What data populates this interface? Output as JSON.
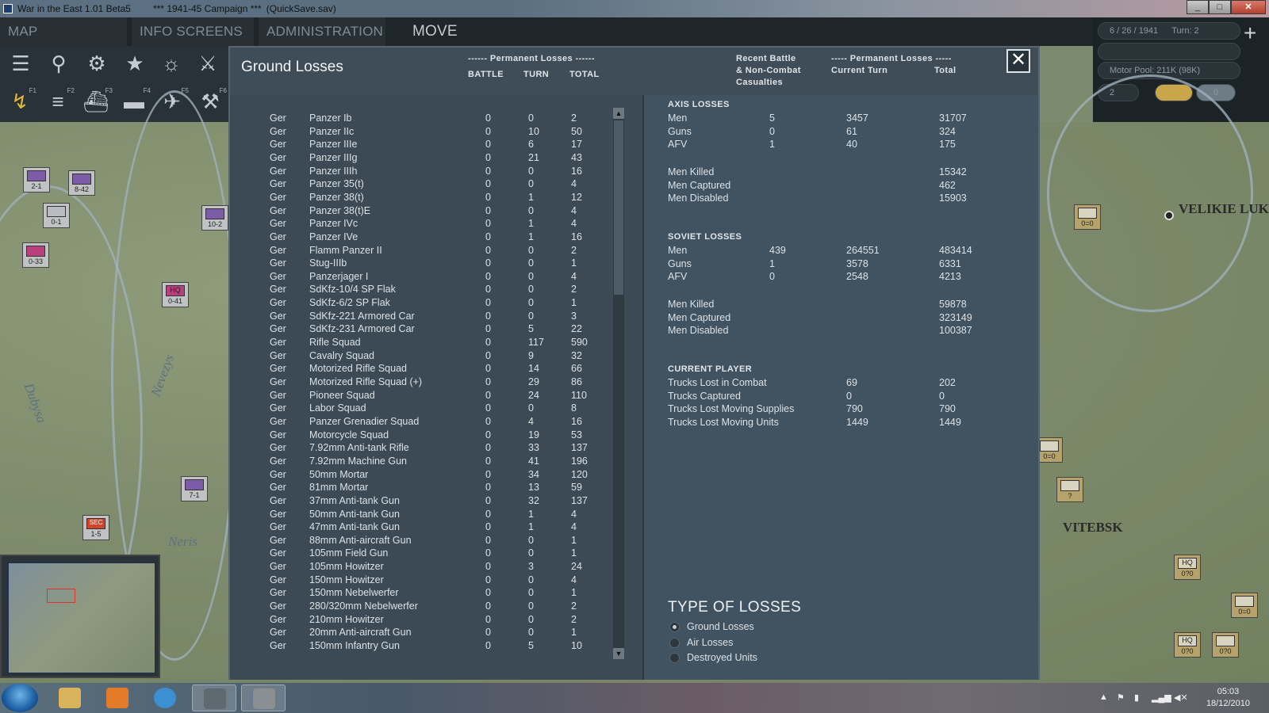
{
  "window": {
    "title": "War in the East 1.01 Beta5",
    "campaign": "***   1941-45 Campaign   ***",
    "save": "(QuickSave.sav)"
  },
  "menu": {
    "tabs": [
      "MAP INFORMATION",
      "INFO SCREENS",
      "ADMINISTRATION"
    ],
    "mode": "MOVE"
  },
  "toolbar": {
    "fkeys": [
      "F1",
      "F2",
      "F3",
      "F4",
      "F5",
      "F6"
    ]
  },
  "status": {
    "date": "6 / 26 / 1941",
    "turn": "Turn: 2",
    "motor_pool": "Motor Pool: 211K (98K)",
    "field": "2",
    "counter": "0"
  },
  "map": {
    "labels": [
      "VELIKIE LUK",
      "VITEBSK"
    ],
    "rivers": [
      "Dubysa",
      "Nevezys",
      "Neris"
    ],
    "units": [
      {
        "id": "2-1",
        "top": "III"
      },
      {
        "id": "8-42",
        "top": "XX"
      },
      {
        "id": "0-1",
        "top": "XXX"
      },
      {
        "id": "0-33",
        "top": "XX"
      },
      {
        "id": "10-2",
        "top": "XX"
      },
      {
        "id": "0-41",
        "top": "XXXX"
      },
      {
        "id": "7-1",
        "top": "XX"
      },
      {
        "id": "1-5",
        "top": "XX"
      },
      {
        "id": "0=0",
        "top": "XX"
      },
      {
        "id": "0=0",
        "top": "XX"
      },
      {
        "id": "?",
        "top": ""
      },
      {
        "id": "0?0",
        "top": "HQ"
      },
      {
        "id": "0=0",
        "top": "XX"
      },
      {
        "id": "0?0",
        "top": "HQ"
      },
      {
        "id": "0?0",
        "top": ""
      }
    ],
    "unit_badges": {
      "hq": "HQ",
      "sec": "SEC"
    }
  },
  "dialog": {
    "title": "Ground Losses",
    "close": "✕",
    "left_header": {
      "group": "------ Permanent Losses ------",
      "battle": "BATTLE",
      "turn": "TURN",
      "total": "TOTAL"
    },
    "right_header": {
      "recent_1": "Recent Battle",
      "recent_2": "& Non-Combat",
      "recent_3": "Casualties",
      "group": "----- Permanent Losses -----",
      "current": "Current Turn",
      "total": "Total"
    },
    "losses": [
      [
        "Ger",
        "Panzer Ib",
        "0",
        "0",
        "2"
      ],
      [
        "Ger",
        "Panzer IIc",
        "0",
        "10",
        "50"
      ],
      [
        "Ger",
        "Panzer IIIe",
        "0",
        "6",
        "17"
      ],
      [
        "Ger",
        "Panzer IIIg",
        "0",
        "21",
        "43"
      ],
      [
        "Ger",
        "Panzer IIIh",
        "0",
        "0",
        "16"
      ],
      [
        "Ger",
        "Panzer 35(t)",
        "0",
        "0",
        "4"
      ],
      [
        "Ger",
        "Panzer 38(t)",
        "0",
        "1",
        "12"
      ],
      [
        "Ger",
        "Panzer 38(t)E",
        "0",
        "0",
        "4"
      ],
      [
        "Ger",
        "Panzer IVc",
        "0",
        "1",
        "4"
      ],
      [
        "Ger",
        "Panzer IVe",
        "0",
        "1",
        "16"
      ],
      [
        "Ger",
        "Flamm Panzer II",
        "0",
        "0",
        "2"
      ],
      [
        "Ger",
        "Stug-IIIb",
        "0",
        "0",
        "1"
      ],
      [
        "Ger",
        "Panzerjager I",
        "0",
        "0",
        "4"
      ],
      [
        "Ger",
        "SdKfz-10/4 SP Flak",
        "0",
        "0",
        "2"
      ],
      [
        "Ger",
        "SdKfz-6/2 SP Flak",
        "0",
        "0",
        "1"
      ],
      [
        "Ger",
        "SdKfz-221 Armored Car",
        "0",
        "0",
        "3"
      ],
      [
        "Ger",
        "SdKfz-231 Armored Car",
        "0",
        "5",
        "22"
      ],
      [
        "Ger",
        "Rifle Squad",
        "0",
        "117",
        "590"
      ],
      [
        "Ger",
        "Cavalry Squad",
        "0",
        "9",
        "32"
      ],
      [
        "Ger",
        "Motorized Rifle Squad",
        "0",
        "14",
        "66"
      ],
      [
        "Ger",
        "Motorized Rifle Squad (+)",
        "0",
        "29",
        "86"
      ],
      [
        "Ger",
        "Pioneer Squad",
        "0",
        "24",
        "110"
      ],
      [
        "Ger",
        "Labor Squad",
        "0",
        "0",
        "8"
      ],
      [
        "Ger",
        "Panzer Grenadier Squad",
        "0",
        "4",
        "16"
      ],
      [
        "Ger",
        "Motorcycle Squad",
        "0",
        "19",
        "53"
      ],
      [
        "Ger",
        "7.92mm Anti-tank Rifle",
        "0",
        "33",
        "137"
      ],
      [
        "Ger",
        "7.92mm Machine Gun",
        "0",
        "41",
        "196"
      ],
      [
        "Ger",
        "50mm Mortar",
        "0",
        "34",
        "120"
      ],
      [
        "Ger",
        "81mm Mortar",
        "0",
        "13",
        "59"
      ],
      [
        "Ger",
        "37mm Anti-tank Gun",
        "0",
        "32",
        "137"
      ],
      [
        "Ger",
        "50mm Anti-tank Gun",
        "0",
        "1",
        "4"
      ],
      [
        "Ger",
        "47mm Anti-tank Gun",
        "0",
        "1",
        "4"
      ],
      [
        "Ger",
        "88mm Anti-aircraft Gun",
        "0",
        "0",
        "1"
      ],
      [
        "Ger",
        "105mm Field Gun",
        "0",
        "0",
        "1"
      ],
      [
        "Ger",
        "105mm Howitzer",
        "0",
        "3",
        "24"
      ],
      [
        "Ger",
        "150mm Howitzer",
        "0",
        "0",
        "4"
      ],
      [
        "Ger",
        "150mm Nebelwerfer",
        "0",
        "0",
        "1"
      ],
      [
        "Ger",
        "280/320mm Nebelwerfer",
        "0",
        "0",
        "2"
      ],
      [
        "Ger",
        "210mm Howitzer",
        "0",
        "0",
        "2"
      ],
      [
        "Ger",
        "20mm Anti-aircraft Gun",
        "0",
        "0",
        "1"
      ],
      [
        "Ger",
        "150mm Infantry Gun",
        "0",
        "5",
        "10"
      ]
    ],
    "axis": {
      "title": "AXIS LOSSES",
      "rows": [
        [
          "Men",
          "5",
          "3457",
          "31707"
        ],
        [
          "Guns",
          "0",
          "61",
          "324"
        ],
        [
          "AFV",
          "1",
          "40",
          "175"
        ]
      ],
      "casualties": [
        [
          "Men Killed",
          "15342"
        ],
        [
          "Men Captured",
          "462"
        ],
        [
          "Men Disabled",
          "15903"
        ]
      ]
    },
    "soviet": {
      "title": "SOVIET LOSSES",
      "rows": [
        [
          "Men",
          "439",
          "264551",
          "483414"
        ],
        [
          "Guns",
          "1",
          "3578",
          "6331"
        ],
        [
          "AFV",
          "0",
          "2548",
          "4213"
        ]
      ],
      "casualties": [
        [
          "Men Killed",
          "59878"
        ],
        [
          "Men Captured",
          "323149"
        ],
        [
          "Men Disabled",
          "100387"
        ]
      ]
    },
    "current_player": {
      "title": "CURRENT PLAYER",
      "rows": [
        [
          "Trucks Lost in Combat",
          "69",
          "202"
        ],
        [
          "Trucks Captured",
          "0",
          "0"
        ],
        [
          "Trucks Lost Moving Supplies",
          "790",
          "790"
        ],
        [
          "Trucks Lost Moving Units",
          "1449",
          "1449"
        ]
      ]
    },
    "type_of_losses": {
      "title": "TYPE OF LOSSES",
      "options": [
        "Ground Losses",
        "Air Losses",
        "Destroyed Units"
      ],
      "selected": 0
    }
  },
  "taskbar": {
    "time": "05:03",
    "date": "18/12/2010",
    "apps": [
      "start",
      "explorer",
      "media-player",
      "internet-explorer",
      "witw-1",
      "witw-2"
    ]
  }
}
